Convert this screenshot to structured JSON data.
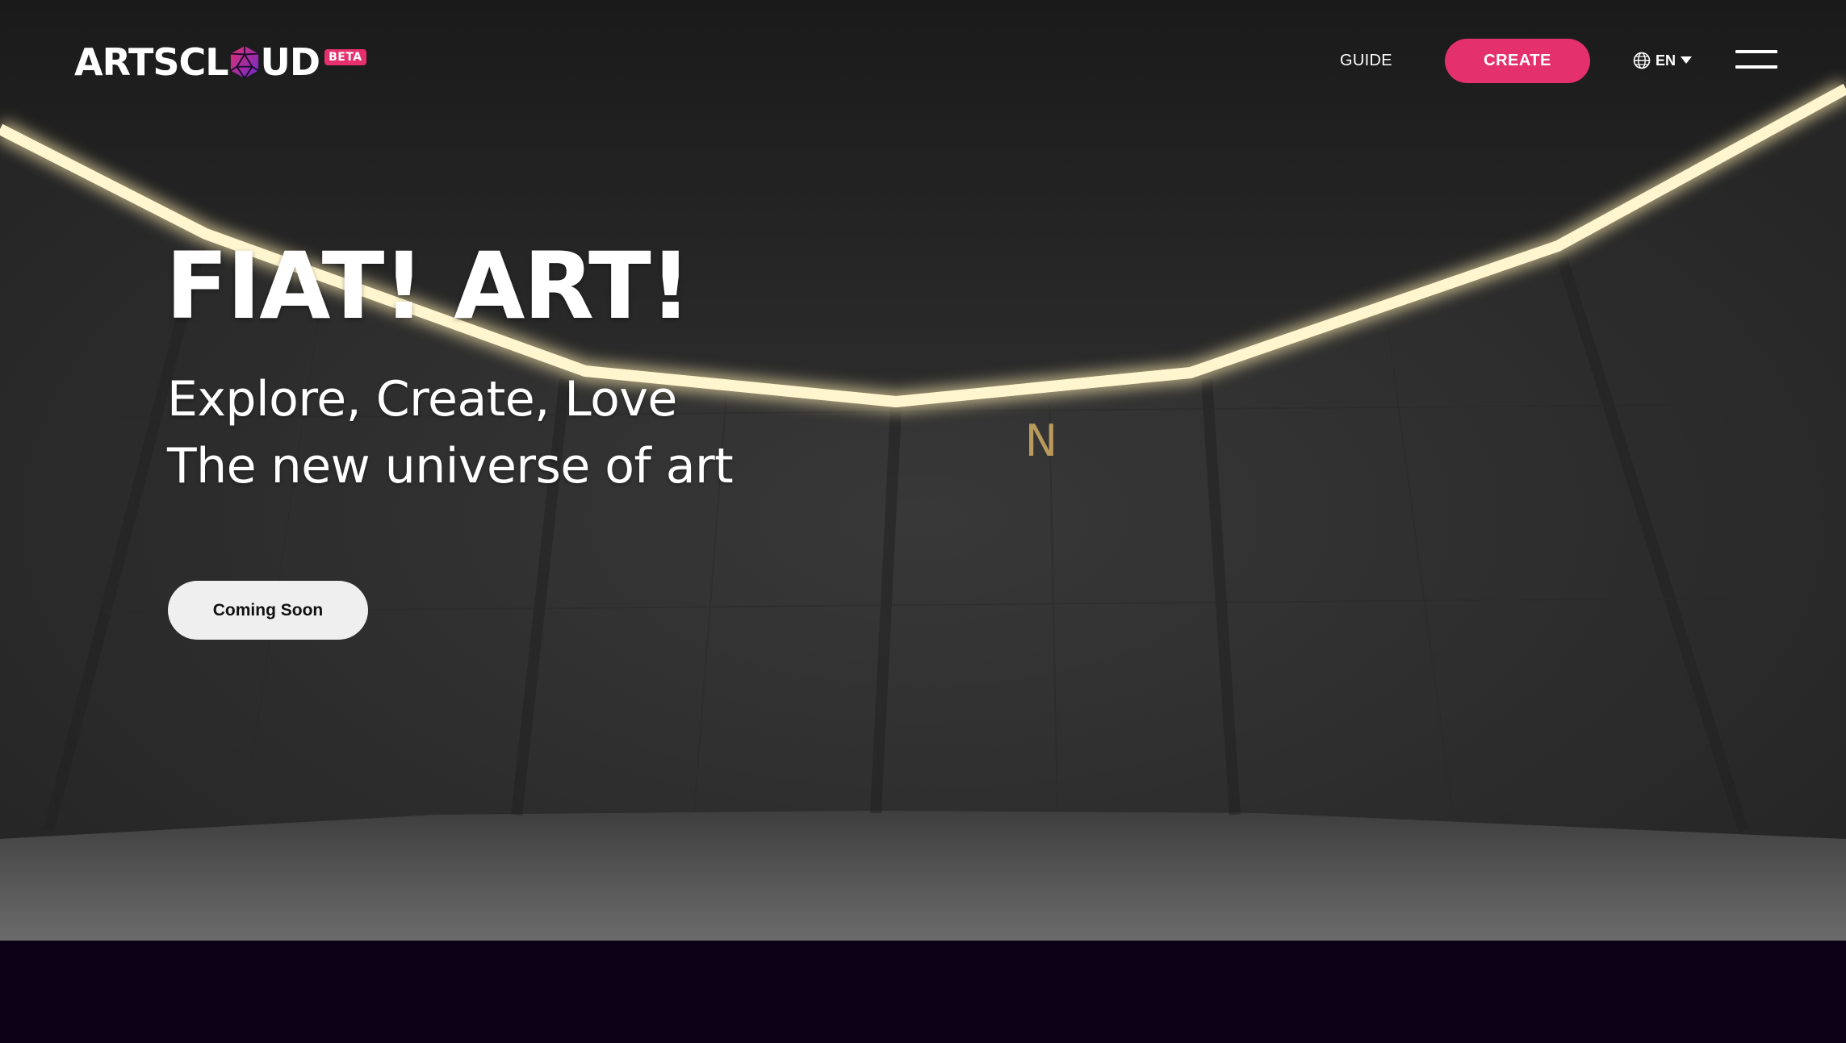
{
  "header": {
    "logo": {
      "text_left": "ARTSCL",
      "text_right": "UD",
      "badge": "BETA",
      "gem_icon": "d20-dice-icon"
    },
    "nav": {
      "guide_label": "GUIDE",
      "create_label": "CREATE",
      "language": {
        "label": "EN",
        "icon": "globe-icon",
        "caret_icon": "caret-down-icon"
      },
      "menu_icon": "hamburger-menu-icon"
    }
  },
  "hero": {
    "headline": "FIAT! ART!",
    "subtitle_line1": "Explore, Create, Love",
    "subtitle_line2": "The new universe of art",
    "cta_label": "Coming Soon",
    "wall_sign": "N"
  },
  "colors": {
    "accent": "#e5306e",
    "footer_band": "#0d0118",
    "cta_background": "#efefef",
    "light_strip": "#fff6cf"
  }
}
